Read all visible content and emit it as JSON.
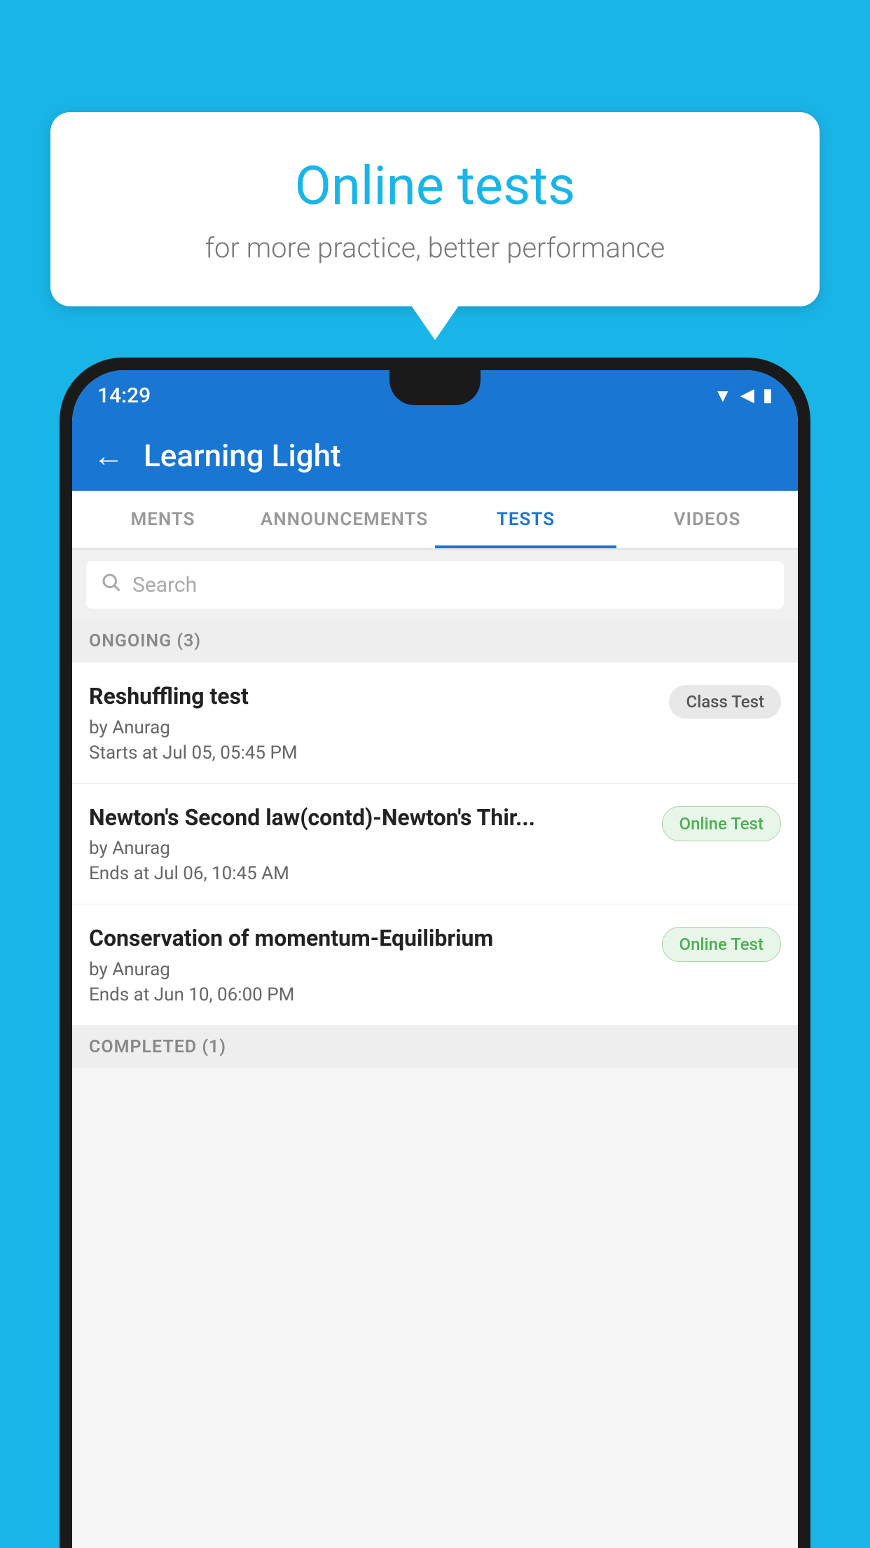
{
  "background": {
    "color": "#1ab5e8"
  },
  "speech_bubble": {
    "title": "Online tests",
    "subtitle": "for more practice, better performance"
  },
  "phone": {
    "status_bar": {
      "time": "14:29",
      "icons": [
        "wifi",
        "signal",
        "battery"
      ]
    },
    "app_header": {
      "title": "Learning Light",
      "back_label": "←"
    },
    "tabs": [
      {
        "label": "MENTS",
        "active": false
      },
      {
        "label": "ANNOUNCEMENTS",
        "active": false
      },
      {
        "label": "TESTS",
        "active": true
      },
      {
        "label": "VIDEOS",
        "active": false
      }
    ],
    "search": {
      "placeholder": "Search"
    },
    "ongoing_section": {
      "label": "ONGOING (3)",
      "tests": [
        {
          "name": "Reshuffling test",
          "author": "by Anurag",
          "date": "Starts at  Jul 05, 05:45 PM",
          "badge": "Class Test",
          "badge_type": "class"
        },
        {
          "name": "Newton's Second law(contd)-Newton's Thir...",
          "author": "by Anurag",
          "date": "Ends at  Jul 06, 10:45 AM",
          "badge": "Online Test",
          "badge_type": "online"
        },
        {
          "name": "Conservation of momentum-Equilibrium",
          "author": "by Anurag",
          "date": "Ends at  Jun 10, 06:00 PM",
          "badge": "Online Test",
          "badge_type": "online"
        }
      ]
    },
    "completed_section": {
      "label": "COMPLETED (1)"
    }
  }
}
